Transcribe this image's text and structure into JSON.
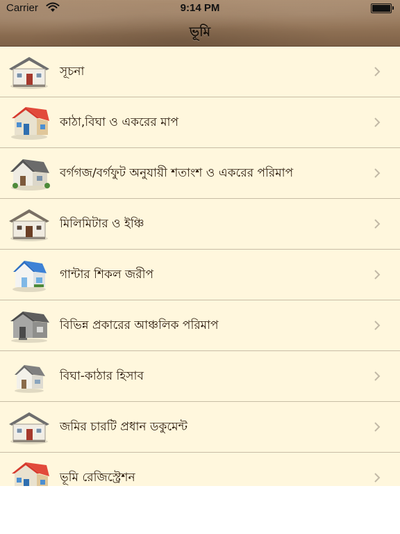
{
  "status_bar": {
    "carrier": "Carrier",
    "time": "9:14 PM",
    "wifi_icon": "wifi-icon",
    "battery_icon": "battery-icon"
  },
  "nav": {
    "title": "ভূমি"
  },
  "items": [
    {
      "label": "সূচনা",
      "icon": "house-icon"
    },
    {
      "label": "কাঠা,বিঘা ও একরের মাপ",
      "icon": "house-icon"
    },
    {
      "label": "বর্গগজ/বর্গফুট অনুযায়ী শতাংশ ও একরের পরিমাপ",
      "icon": "house-icon"
    },
    {
      "label": "মিলিমিটার ও ইঞ্চি",
      "icon": "house-icon"
    },
    {
      "label": "গান্টার শিকল জরীপ",
      "icon": "house-icon"
    },
    {
      "label": "বিভিন্ন প্রকারের আঞ্চলিক পরিমাপ",
      "icon": "house-icon"
    },
    {
      "label": "বিঘা-কাঠার হিসাব",
      "icon": "house-icon"
    },
    {
      "label": "জমির চারটি প্রধান ডকুমেন্ট",
      "icon": "house-icon"
    },
    {
      "label": "ভূমি রেজিস্ট্রেশন",
      "icon": "house-icon"
    }
  ],
  "colors": {
    "row_bg": "#fff7dd",
    "separator": "#c7bda5",
    "header": "#947558",
    "chevron": "#c2b9a6"
  }
}
